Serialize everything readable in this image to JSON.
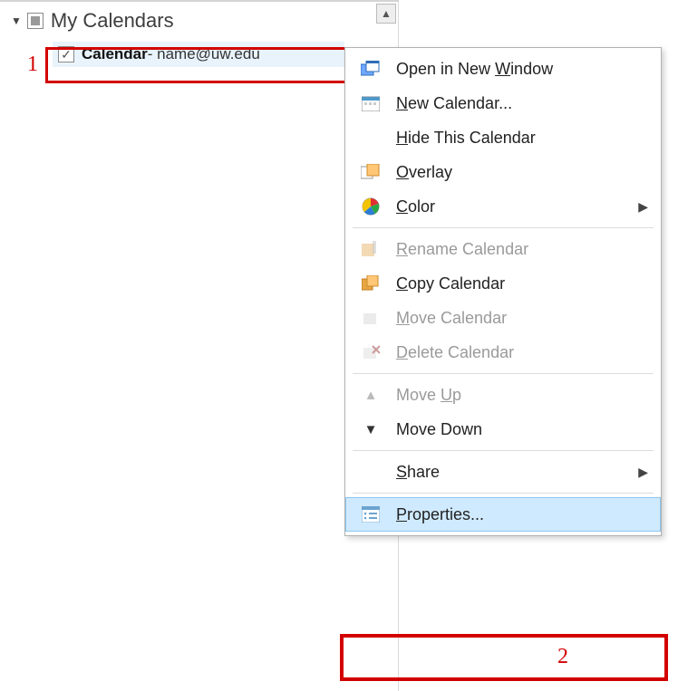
{
  "nav": {
    "group_label": "My Calendars",
    "calendar_item": {
      "name": "Calendar",
      "suffix": " - name@uw.edu"
    }
  },
  "annotations": {
    "one": "1",
    "two": "2"
  },
  "menu": {
    "open_new_window": "Open in New Window",
    "new_calendar": "New Calendar...",
    "hide_calendar": "Hide This Calendar",
    "overlay": "Overlay",
    "color": "Color",
    "rename": "Rename Calendar",
    "copy": "Copy Calendar",
    "move": "Move Calendar",
    "delete": "Delete Calendar",
    "move_up": "Move Up",
    "move_down": "Move Down",
    "share": "Share",
    "properties": "Properties..."
  }
}
